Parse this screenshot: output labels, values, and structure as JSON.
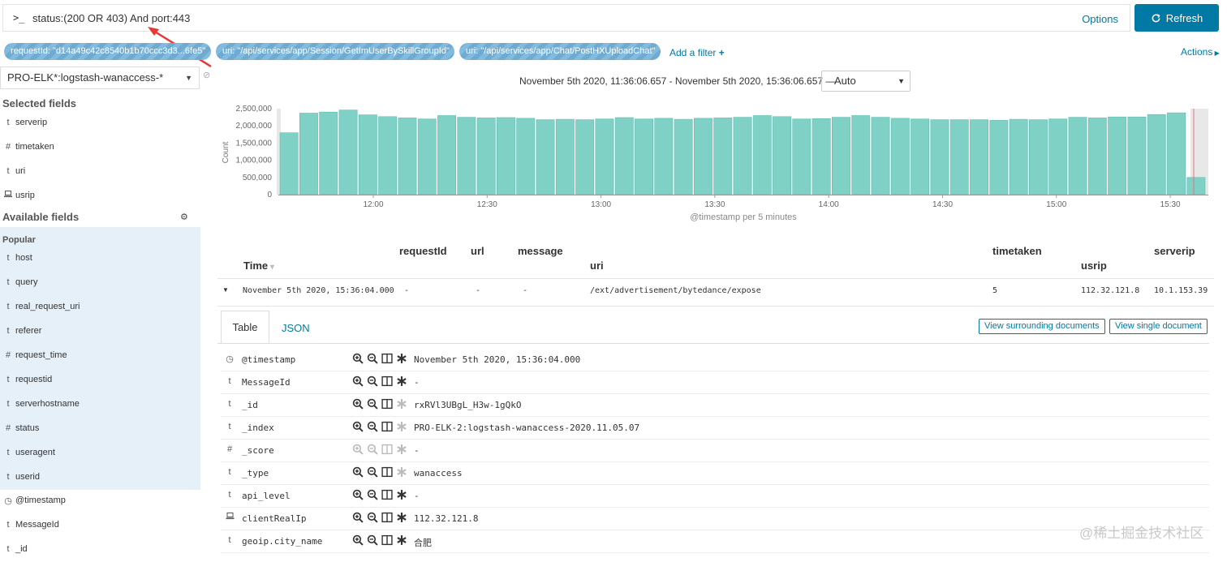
{
  "search": {
    "prompt": ">_",
    "query": "status:(200 OR 403) And port:443",
    "options": "Options",
    "refresh": "Refresh"
  },
  "filters": {
    "pills": [
      "requestId: \"d14a49c42c8540b1b70ccc3d3...6fe5\"",
      "uri: \"/api/services/app/Session/GetImUserBySkillGroupId\"",
      "uri: \"/api/services/app/Chat/PostHXUploadChat\""
    ],
    "add_filter": "Add a filter",
    "actions": "Actions"
  },
  "sidebar": {
    "index_pattern": "PRO-ELK*:logstash-wanaccess-*",
    "selected_title": "Selected fields",
    "selected": [
      {
        "type": "t",
        "name": "serverip"
      },
      {
        "type": "#",
        "name": "timetaken"
      },
      {
        "type": "t",
        "name": "uri"
      },
      {
        "type": "ip",
        "name": "usrip"
      }
    ],
    "available_title": "Available fields",
    "popular_title": "Popular",
    "popular": [
      {
        "type": "t",
        "name": "host"
      },
      {
        "type": "t",
        "name": "query"
      },
      {
        "type": "t",
        "name": "real_request_uri"
      },
      {
        "type": "t",
        "name": "referer"
      },
      {
        "type": "#",
        "name": "request_time"
      },
      {
        "type": "t",
        "name": "requestid"
      },
      {
        "type": "t",
        "name": "serverhostname"
      },
      {
        "type": "#",
        "name": "status"
      },
      {
        "type": "t",
        "name": "useragent"
      },
      {
        "type": "t",
        "name": "userid"
      }
    ],
    "other": [
      {
        "type": "clock",
        "name": "@timestamp"
      },
      {
        "type": "t",
        "name": "MessageId"
      },
      {
        "type": "t",
        "name": "_id"
      }
    ]
  },
  "time": {
    "range": "November 5th 2020, 11:36:06.657 - November 5th 2020, 15:36:06.657 —",
    "interval": "Auto"
  },
  "chart_data": {
    "type": "bar",
    "ylabel": "Count",
    "xlabel": "@timestamp per 5 minutes",
    "ylim": [
      0,
      2500000
    ],
    "y_ticks": [
      "2,500,000",
      "2,000,000",
      "1,500,000",
      "1,000,000",
      "500,000",
      "0"
    ],
    "x_ticks": [
      "12:00",
      "12:30",
      "13:00",
      "13:30",
      "14:00",
      "14:30",
      "15:00",
      "15:30"
    ],
    "values": [
      1800000,
      2370000,
      2400000,
      2460000,
      2320000,
      2270000,
      2230000,
      2200000,
      2300000,
      2250000,
      2230000,
      2240000,
      2220000,
      2180000,
      2190000,
      2180000,
      2200000,
      2240000,
      2200000,
      2220000,
      2190000,
      2220000,
      2230000,
      2250000,
      2300000,
      2270000,
      2200000,
      2210000,
      2250000,
      2300000,
      2250000,
      2220000,
      2200000,
      2180000,
      2180000,
      2180000,
      2160000,
      2190000,
      2180000,
      2200000,
      2250000,
      2230000,
      2260000,
      2260000,
      2330000,
      2380000,
      500000
    ],
    "color": "#7fd1c6"
  },
  "table": {
    "headers": {
      "time": "Time",
      "requestId": "requestId",
      "url": "url",
      "message": "message",
      "uri": "uri",
      "timetaken": "timetaken",
      "usrip": "usrip",
      "serverip": "serverip"
    },
    "row": {
      "time": "November 5th 2020, 15:36:04.000",
      "requestId": "-",
      "url": "-",
      "message": "-",
      "uri": "/ext/advertisement/bytedance/expose",
      "timetaken": "5",
      "usrip": "112.32.121.8",
      "serverip": "10.1.153.39"
    }
  },
  "detail": {
    "tabs": [
      "Table",
      "JSON"
    ],
    "view_surrounding": "View surrounding documents",
    "view_single": "View single document",
    "rows": [
      {
        "type": "clock",
        "name": "@timestamp",
        "value": "November 5th 2020, 15:36:04.000"
      },
      {
        "type": "t",
        "name": "MessageId",
        "value": "-"
      },
      {
        "type": "t",
        "name": "_id",
        "value": "rxRVl3UBgL_H3w-1gQkO"
      },
      {
        "type": "t",
        "name": "_index",
        "value": "PRO-ELK-2:logstash-wanaccess-2020.11.05.07"
      },
      {
        "type": "#",
        "name": "_score",
        "value": " -"
      },
      {
        "type": "t",
        "name": "_type",
        "value": "wanaccess"
      },
      {
        "type": "t",
        "name": "api_level",
        "value": "-"
      },
      {
        "type": "ip",
        "name": "clientRealIp",
        "value": "112.32.121.8"
      },
      {
        "type": "t",
        "name": "geoip.city_name",
        "value": "合肥"
      }
    ]
  },
  "watermark": "@稀土掘金技术社区"
}
